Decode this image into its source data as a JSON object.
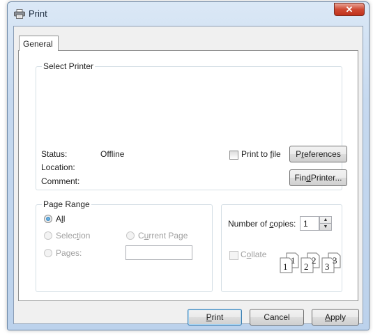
{
  "window": {
    "title": "Print",
    "close_icon": "close-icon",
    "printer_icon": "printer-icon"
  },
  "tabs": [
    {
      "label": "General",
      "selected": true
    }
  ],
  "select_printer": {
    "group_title": "Select Printer",
    "status_label": "Status:",
    "status_value": "Offline",
    "location_label": "Location:",
    "comment_label": "Comment:",
    "print_to_file": {
      "label_pre": "Print to ",
      "label_ul": "f",
      "label_post": "ile",
      "checked": false
    },
    "preferences_button": {
      "label_pre": "P",
      "label_ul": "r",
      "label_post": "eferences"
    },
    "find_printer_button": {
      "label_pre": "Fin",
      "label_ul": "d",
      "label_post": " Printer..."
    }
  },
  "page_range": {
    "group_title": "Page Range",
    "all": {
      "label_pre": "A",
      "label_ul": "l",
      "label_post": "l",
      "checked": true
    },
    "selection": {
      "label_pre": "Selec",
      "label_ul": "t",
      "label_post": "ion",
      "enabled": false
    },
    "current_page": {
      "label_pre": "C",
      "label_ul": "u",
      "label_post": "rrent Page",
      "enabled": false
    },
    "pages": {
      "label_pre": "Pa",
      "label_ul": "g",
      "label_post": "es:",
      "value": ""
    }
  },
  "copies": {
    "label_pre": "Number of ",
    "label_ul": "c",
    "label_post": "opies:",
    "value": "1",
    "collate": {
      "label_pre": "C",
      "label_ul": "o",
      "label_post": "llate",
      "checked": false,
      "enabled": false
    },
    "collate_pages": [
      "1",
      "1",
      "2",
      "2",
      "3",
      "3"
    ]
  },
  "footer": {
    "print_button": {
      "label_pre": "",
      "label_ul": "P",
      "label_post": "rint"
    },
    "cancel_button": {
      "label": "Cancel"
    },
    "apply_button": {
      "label_pre": "",
      "label_ul": "A",
      "label_post": "pply"
    }
  },
  "colors": {
    "accent": "#3c7fb1",
    "close": "#c0321c"
  }
}
